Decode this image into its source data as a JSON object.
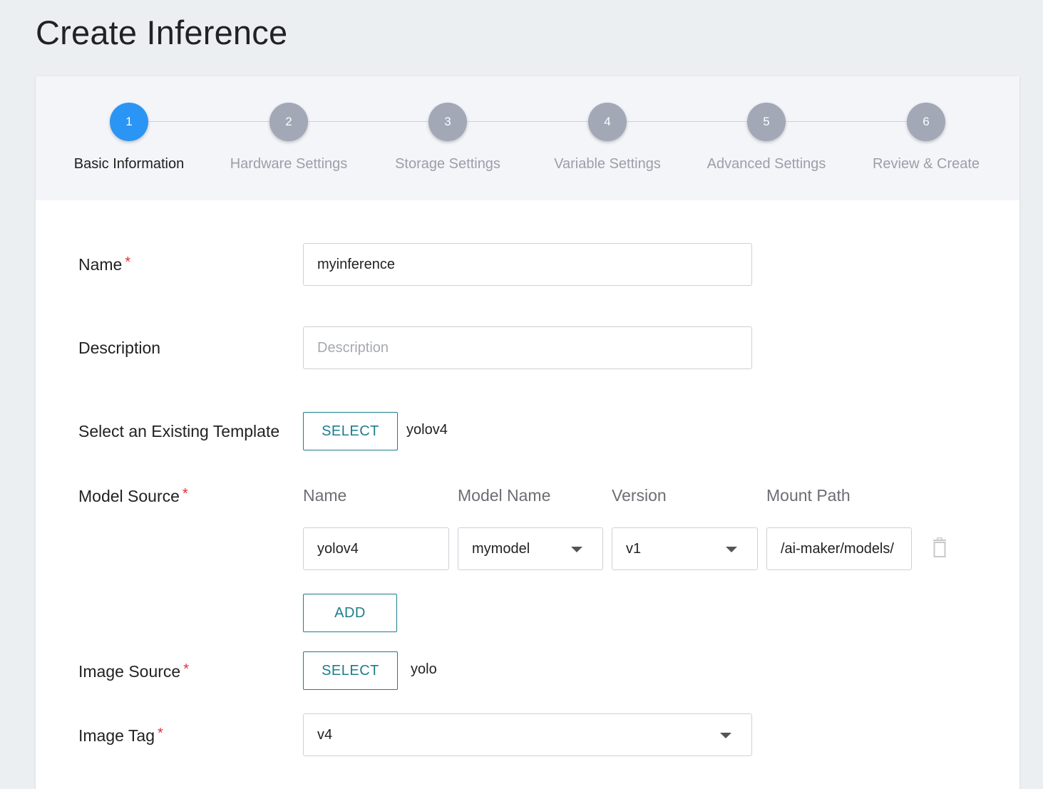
{
  "page": {
    "title": "Create Inference"
  },
  "stepper": {
    "steps": [
      {
        "number": "1",
        "label": "Basic Information",
        "active": true
      },
      {
        "number": "2",
        "label": "Hardware Settings",
        "active": false
      },
      {
        "number": "3",
        "label": "Storage Settings",
        "active": false
      },
      {
        "number": "4",
        "label": "Variable Settings",
        "active": false
      },
      {
        "number": "5",
        "label": "Advanced Settings",
        "active": false
      },
      {
        "number": "6",
        "label": "Review & Create",
        "active": false
      }
    ],
    "colors": {
      "active": "#2b95f5",
      "inactive": "#a2a8b6"
    }
  },
  "form": {
    "name": {
      "label": "Name",
      "required": "*",
      "value": "myinference"
    },
    "description": {
      "label": "Description",
      "placeholder": "Description",
      "value": ""
    },
    "template": {
      "label": "Select an Existing Template",
      "button": "SELECT",
      "selected": "yolov4"
    },
    "model_source": {
      "label": "Model Source",
      "required": "*",
      "columns": {
        "name": "Name",
        "model_name": "Model Name",
        "version": "Version",
        "mount_path": "Mount Path"
      },
      "rows": [
        {
          "name": "yolov4",
          "model_name": "mymodel",
          "version": "v1",
          "mount_path": "/ai-maker/models/"
        }
      ],
      "add_button": "ADD",
      "delete_icon": "trash-icon"
    },
    "image_source": {
      "label": "Image Source",
      "required": "*",
      "button": "SELECT",
      "selected": "yolo"
    },
    "image_tag": {
      "label": "Image Tag",
      "required": "*",
      "value": "v4"
    }
  },
  "colors": {
    "accent": "#1c7d8c",
    "required": "#e0303a",
    "background": "#eceff2"
  }
}
